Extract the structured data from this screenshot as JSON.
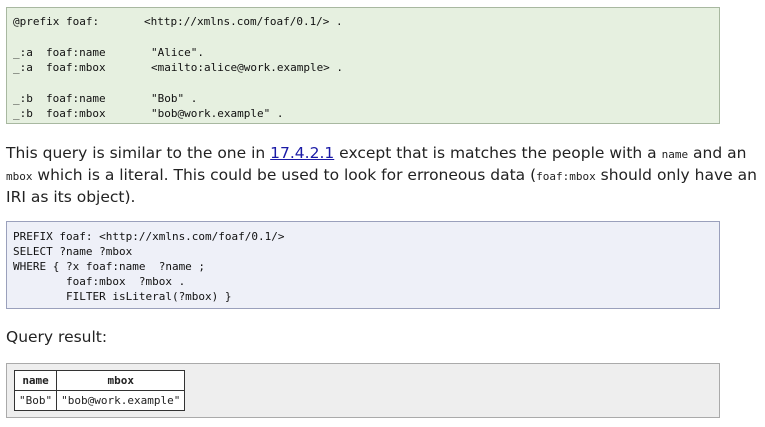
{
  "data_block": {
    "lines": [
      {
        "c1": "@prefix foaf:",
        "c2": "",
        "c3": "<http://xmlns.com/foaf/0.1/> ."
      },
      {
        "c1": "_:a",
        "c2": "foaf:name",
        "c3": "\"Alice\"."
      },
      {
        "c1": "_:a",
        "c2": "foaf:mbox",
        "c3": "<mailto:alice@work.example> ."
      },
      {
        "c1": "_:b",
        "c2": "foaf:name",
        "c3": "\"Bob\" ."
      },
      {
        "c1": "_:b",
        "c2": "foaf:mbox",
        "c3": "\"bob@work.example\" ."
      }
    ]
  },
  "paragraph": {
    "t1": "This query is similar to the one in ",
    "link": "17.4.2.1",
    "t2": " except that is matches the people with a ",
    "code_name": "name",
    "t3": " and an ",
    "code_mbox": "mbox",
    "t4": " which is a literal. This could be used to look for erroneous data (",
    "code_foaf_mbox": "foaf:mbox",
    "t5": " should only have an IRI as its object)."
  },
  "query_block": {
    "lines": [
      "PREFIX foaf: <http://xmlns.com/foaf/0.1/>",
      "SELECT ?name ?mbox",
      "WHERE { ?x foaf:name  ?name ;",
      "        foaf:mbox  ?mbox .",
      "        FILTER isLiteral(?mbox) }"
    ]
  },
  "result_label": "Query result:",
  "result_table": {
    "headers": [
      "name",
      "mbox"
    ],
    "rows": [
      [
        "\"Bob\"",
        "\"bob@work.example\""
      ]
    ]
  },
  "colors": {
    "data_bg": "#e6f0e0",
    "query_bg": "#eef0f8",
    "result_bg": "#eeeeee",
    "link": "#1a1aa6"
  }
}
